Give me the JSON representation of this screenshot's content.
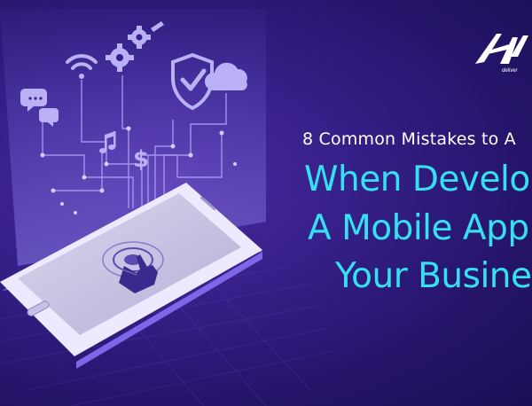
{
  "banner": {
    "subtitle": "8 Common Mistakes to A",
    "title_lines": [
      "When Develop",
      "A Mobile App F",
      "Your Business"
    ],
    "logo": {
      "tagline": "deliver",
      "mark": "A"
    },
    "colors": {
      "background": "#2b1a7a",
      "title": "#35e0f0",
      "subtitle": "#ffffff",
      "icons": "#b9b0f5",
      "phone_screen": "#c9c5e0"
    },
    "icons": [
      "chat-bubbles-icon",
      "wifi-icon",
      "gears-icon",
      "shield-check-icon",
      "cloud-icon",
      "music-note-icon",
      "dollar-icon",
      "tap-hand-icon"
    ]
  }
}
